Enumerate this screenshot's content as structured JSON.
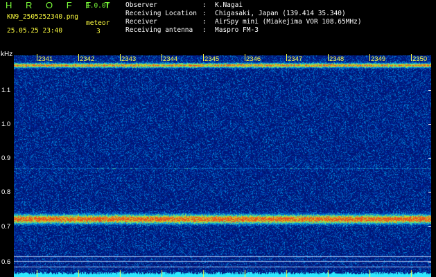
{
  "header": {
    "app_name": "H R O F F T",
    "version": "1.0.0f",
    "file_name": "KN9_2505252340.png",
    "timestamp": "25.05.25 23:40",
    "meteor_label": "meteor",
    "meteor_count": "3"
  },
  "metadata": [
    {
      "label": "Observer",
      "value": "K.Nagai"
    },
    {
      "label": "Receiving Location",
      "value": "Chigasaki, Japan (139.414 35.340)"
    },
    {
      "label": "Receiver",
      "value": "AirSpy mini (Miakejima VOR 108.65MHz)"
    },
    {
      "label": "Receiving antenna",
      "value": "Maspro FM-3"
    }
  ],
  "colon": ":",
  "frequency_axis": {
    "unit": "kHz",
    "ticks": [
      "1.1",
      "1.0",
      "0.9",
      "0.8",
      "0.7",
      "0.6"
    ]
  },
  "time_axis": {
    "minutes": [
      "2341",
      "2342",
      "2343",
      "2344",
      "2345",
      "2346",
      "2347",
      "2348",
      "2349",
      "2350"
    ]
  },
  "colors": {
    "background": "#000000",
    "header_green": "#7CFF3A",
    "header_yellow": "#FFFF40",
    "spectrogram_base": "#0a1a7a",
    "signal_band": "#e04020"
  }
}
